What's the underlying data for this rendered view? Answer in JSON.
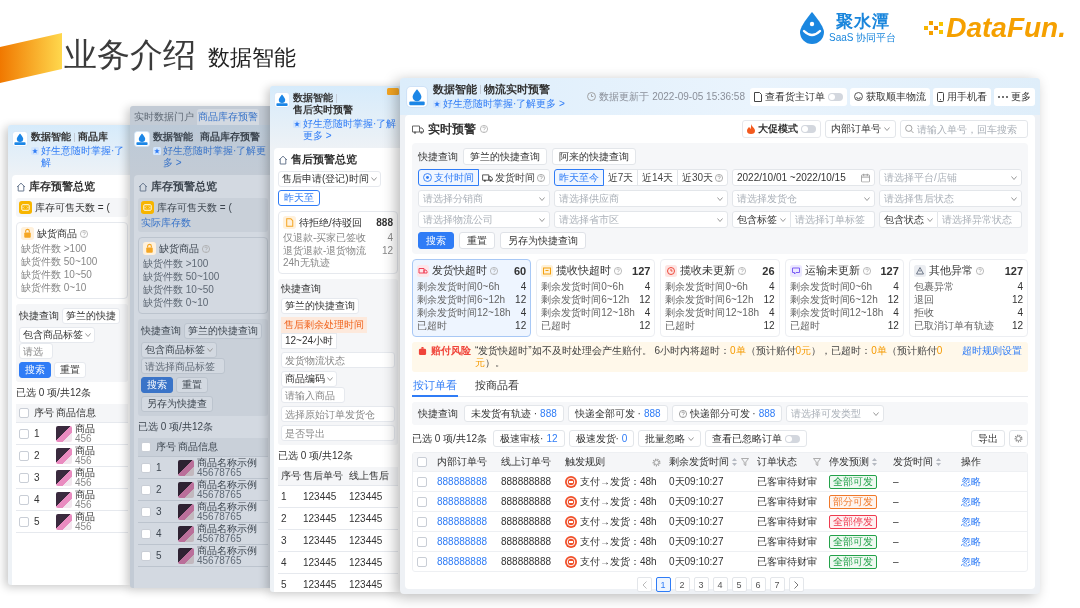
{
  "slide": {
    "title": "业务介绍",
    "subtitle": "数据智能"
  },
  "logos": [
    {
      "kind": "jushuitan",
      "name": "聚水潭",
      "tagline": "SaaS 协同平台"
    },
    {
      "kind": "datafun",
      "name": "DataFun."
    }
  ],
  "windows": [
    {
      "kind": "inventory",
      "dimmed": false,
      "app": "数据智能",
      "page": "商品库",
      "tagline": "好生意随时掌握·了解",
      "overview": "库存预警总览",
      "formula": "库存可售天数 = (",
      "card": {
        "title": "缺货商品",
        "lines": [
          "缺货件数 >100",
          "缺货件数 50~100",
          "缺货件数 10~50",
          "缺货件数 0~10"
        ]
      },
      "quick_query": {
        "label": "快捷查询",
        "items": [
          "笋兰的快捷"
        ]
      },
      "filter": {
        "label": "包含商品标签",
        "placeholder": "请选"
      },
      "buttons": [
        {
          "kind": "primary",
          "label": "搜索"
        },
        {
          "kind": "default",
          "label": "重置"
        }
      ],
      "selection": "已选 0 项/共12条",
      "table": {
        "select_all": false,
        "columns": [
          "序号",
          "商品信息"
        ],
        "rows": [
          {
            "checked": false,
            "index": "1",
            "name": "商品",
            "code": "456"
          },
          {
            "checked": false,
            "index": "2",
            "name": "商品",
            "code": "456"
          },
          {
            "checked": false,
            "index": "3",
            "name": "商品",
            "code": "456"
          },
          {
            "checked": false,
            "index": "4",
            "name": "商品",
            "code": "456"
          },
          {
            "checked": false,
            "index": "5",
            "name": "商品",
            "code": "456"
          }
        ]
      }
    },
    {
      "kind": "inventory",
      "dimmed": true,
      "tabs": [
        {
          "label": "实时数据门户",
          "selected": false
        },
        {
          "label": "商品库存预警",
          "selected": true
        }
      ],
      "app": "数据智能",
      "page": "商品库存预警",
      "tagline": "好生意随时掌握·了解更多 >",
      "overview": "库存预警总览",
      "formula": "库存可售天数 = (",
      "formula_term": "实际库存数",
      "card": {
        "title": "缺货商品",
        "lines": [
          "缺货件数 >100",
          "缺货件数 50~100",
          "缺货件数 10~50",
          "缺货件数 0~10"
        ]
      },
      "quick_query": {
        "label": "快捷查询",
        "items": [
          "笋兰的快捷查询"
        ]
      },
      "filter": {
        "label": "包含商品标签",
        "placeholder": "请选择商品标签"
      },
      "buttons": [
        {
          "kind": "primary",
          "label": "搜索"
        },
        {
          "kind": "default",
          "label": "重置"
        },
        {
          "kind": "default",
          "label": "另存为快捷查"
        }
      ],
      "selection": "已选 0 项/共12条",
      "table": {
        "select_all": false,
        "columns": [
          "序号",
          "商品信息"
        ],
        "rows": [
          {
            "checked": false,
            "index": "1",
            "name": "商品名称示例",
            "code": "45678765"
          },
          {
            "checked": false,
            "index": "2",
            "name": "商品名称示例",
            "code": "45678765"
          },
          {
            "checked": false,
            "index": "3",
            "name": "商品名称示例",
            "code": "45678765"
          },
          {
            "checked": false,
            "index": "4",
            "name": "商品名称示例",
            "code": "45678765"
          },
          {
            "checked": false,
            "index": "5",
            "name": "商品名称示例",
            "code": "45678765"
          }
        ]
      }
    },
    {
      "kind": "aftersale",
      "dimmed": false,
      "app": "数据智能",
      "page": "售后实时预警",
      "tagline": "好生意随时掌握·了解更多 >",
      "overview": "售后预警总览",
      "time_select": "售后申请(登记)时间",
      "range": "昨天至",
      "card": {
        "title": "待拒绝/待驳回",
        "count": "888",
        "lines": [
          {
            "label": "仅退款-买家已签收",
            "value": "4"
          },
          {
            "label": "退货退款-退货物流24h无轨迹",
            "value": "12"
          }
        ]
      },
      "quick_query": {
        "label": "快捷查询",
        "items": [
          "笋兰的快捷查询"
        ]
      },
      "deadline": {
        "label": "售后剩余处理时间",
        "value": "12~24小时"
      },
      "fields": [
        {
          "kind": "input",
          "placeholder": "发货物流状态"
        },
        {
          "kind": "compound",
          "label": "商品编码",
          "placeholder": "请输入商品"
        },
        {
          "kind": "input",
          "placeholder": "选择原始订单发货仓"
        },
        {
          "kind": "input",
          "placeholder": "是否导出"
        }
      ],
      "selection": "已选 0 项/共12条",
      "table": {
        "columns": [
          "序号",
          "售后单号",
          "线上售后"
        ],
        "rows": [
          {
            "cells": [
              "1",
              "123445",
              "123445"
            ]
          },
          {
            "cells": [
              "2",
              "123445",
              "123445"
            ]
          },
          {
            "cells": [
              "3",
              "123445",
              "123445"
            ]
          },
          {
            "cells": [
              "4",
              "123445",
              "123445"
            ]
          },
          {
            "cells": [
              "5",
              "123445",
              "123445"
            ]
          }
        ]
      }
    }
  ],
  "main_window": {
    "app": "数据智能",
    "page": "物流实时预警",
    "tagline": "好生意随时掌握·了解更多 >",
    "updated": "数据更新于 2022-09-05 15:36:58",
    "actions": [
      {
        "kind": "toggle",
        "label": "查看货主订单",
        "on": false
      },
      {
        "kind": "button",
        "label": "获取顺丰物流"
      },
      {
        "kind": "button",
        "label": "用手机看"
      },
      {
        "kind": "more",
        "label": "更多"
      }
    ],
    "section": "实时预警",
    "promo": {
      "label": "大促模式",
      "on": false
    },
    "search": {
      "scope": "内部订单号",
      "placeholder": "请输入单号，回车搜索"
    },
    "quick_query": {
      "label": "快捷查询",
      "items": [
        "笋兰的快捷查询",
        "阿来的快捷查询"
      ]
    },
    "filters": [
      {
        "kind": "segment",
        "options": [
          {
            "label": "支付时间",
            "selected": true,
            "help": false
          },
          {
            "label": "发货时间",
            "selected": false,
            "help": true
          }
        ]
      },
      {
        "kind": "segment",
        "options": [
          {
            "label": "昨天至今",
            "selected": true,
            "help": false
          },
          {
            "label": "近7天",
            "selected": false,
            "help": false
          },
          {
            "label": "近14天",
            "selected": false,
            "help": false
          },
          {
            "label": "近30天",
            "selected": false,
            "help": true
          }
        ]
      },
      {
        "kind": "date",
        "value": "2022/10/01 ~2022/10/15"
      },
      {
        "kind": "select",
        "placeholder": "请选择平台/店铺"
      },
      {
        "kind": "select",
        "placeholder": "请选择分销商"
      },
      {
        "kind": "select",
        "placeholder": "请选择供应商"
      },
      {
        "kind": "select",
        "placeholder": "请选择发货仓"
      },
      {
        "kind": "select",
        "placeholder": "请选择售后状态"
      },
      {
        "kind": "select",
        "placeholder": "请选择物流公司"
      },
      {
        "kind": "select",
        "placeholder": "请选择省市区"
      },
      {
        "kind": "compound",
        "label": "包含标签",
        "placeholder": "请选择订单标签"
      },
      {
        "kind": "compound",
        "label": "包含状态",
        "placeholder": "请选择异常状态"
      }
    ],
    "buttons": [
      {
        "kind": "primary",
        "label": "搜索"
      },
      {
        "kind": "default",
        "label": "重置"
      },
      {
        "kind": "default",
        "label": "另存为快捷查询"
      }
    ],
    "cards": [
      {
        "kind": "ship",
        "title": "发货快超时",
        "count": "60",
        "selected": true,
        "lines": [
          {
            "label": "剩余发货时间0~6h",
            "value": "4"
          },
          {
            "label": "剩余发货时间6~12h",
            "value": "12"
          },
          {
            "label": "剩余发货时间12~18h",
            "value": "4"
          },
          {
            "label": "已超时",
            "value": "12"
          }
        ]
      },
      {
        "kind": "pickup",
        "title": "揽收快超时",
        "count": "127",
        "selected": false,
        "lines": [
          {
            "label": "剩余发货时间0~6h",
            "value": "4"
          },
          {
            "label": "剩余发货时间6~12h",
            "value": "12"
          },
          {
            "label": "剩余发货时间12~18h",
            "value": "4"
          },
          {
            "label": "已超时",
            "value": "12"
          }
        ]
      },
      {
        "kind": "stale",
        "title": "揽收未更新",
        "count": "26",
        "selected": false,
        "lines": [
          {
            "label": "剩余发货时间0~6h",
            "value": "4"
          },
          {
            "label": "剩余发货时间6~12h",
            "value": "12"
          },
          {
            "label": "剩余发货时间12~18h",
            "value": "4"
          },
          {
            "label": "已超时",
            "value": "12"
          }
        ]
      },
      {
        "kind": "transit",
        "title": "运输未更新",
        "count": "127",
        "selected": false,
        "lines": [
          {
            "label": "剩余发货时间0~6h",
            "value": "4"
          },
          {
            "label": "剩余发货时间6~12h",
            "value": "12"
          },
          {
            "label": "剩余发货时间12~18h",
            "value": "4"
          },
          {
            "label": "已超时",
            "value": "12"
          }
        ]
      },
      {
        "kind": "other",
        "title": "其他异常",
        "count": "127",
        "selected": false,
        "lines": [
          {
            "label": "包裹异常",
            "value": "4"
          },
          {
            "label": "退回",
            "value": "12"
          },
          {
            "label": "拒收",
            "value": "4"
          },
          {
            "label": "已取消订单有轨迹",
            "value": "12"
          }
        ]
      }
    ],
    "alert": {
      "tag": "赔付风险",
      "parts": [
        {
          "text": "“发货快超时”如不及时处理会产生赔付。 6小时内将超时：",
          "highlight": false
        },
        {
          "text": "0单",
          "highlight": true
        },
        {
          "text": "（预计赔付",
          "highlight": false
        },
        {
          "text": "0元",
          "highlight": true
        },
        {
          "text": "），已超时：",
          "highlight": false
        },
        {
          "text": "0单",
          "highlight": true
        },
        {
          "text": "（预计赔付",
          "highlight": false
        },
        {
          "text": "0元",
          "highlight": true
        },
        {
          "text": "）。",
          "highlight": false
        }
      ],
      "link": "超时规则设置"
    },
    "view_tabs": [
      {
        "label": "按订单看",
        "selected": true
      },
      {
        "label": "按商品看",
        "selected": false
      }
    ],
    "order_quick": {
      "label": "快捷查询",
      "chips": [
        {
          "label": "未发货有轨迹 ·",
          "count": "888",
          "help": false
        },
        {
          "label": "快递全部可发 ·",
          "count": "888",
          "help": false
        },
        {
          "label": "快递部分可发 ·",
          "count": "888",
          "help": true
        }
      ],
      "type_placeholder": "请选择可发类型"
    },
    "toolbar": {
      "selection": "已选 0 项/共12条",
      "actions": [
        {
          "kind": "count",
          "label": "极速审核·",
          "count": "12"
        },
        {
          "kind": "count",
          "label": "极速发货·",
          "count": "0"
        },
        {
          "kind": "menu",
          "label": "批量忽略"
        },
        {
          "kind": "toggle",
          "label": "查看已忽略订单",
          "on": false
        }
      ],
      "export": "导出"
    },
    "table": {
      "select_all": false,
      "columns": [
        {
          "label": "内部订单号",
          "sort": false,
          "filter": false,
          "gear": false
        },
        {
          "label": "线上订单号",
          "sort": false,
          "filter": false,
          "gear": false
        },
        {
          "label": "触发规则",
          "sort": false,
          "filter": false,
          "gear": true
        },
        {
          "label": "剩余发货时间",
          "sort": true,
          "filter": true,
          "gear": false
        },
        {
          "label": "订单状态",
          "sort": false,
          "filter": true,
          "gear": false
        },
        {
          "label": "停发预测",
          "sort": true,
          "filter": false,
          "gear": false
        },
        {
          "label": "发货时间",
          "sort": true,
          "filter": false,
          "gear": false
        },
        {
          "label": "操作",
          "sort": false,
          "filter": false,
          "gear": false
        }
      ],
      "rows": [
        {
          "checked": false,
          "order_no": "888888888",
          "online_no": "888888888",
          "rule": "支付→发货：48h",
          "remaining": "0天09:10:27",
          "status": "已客审待财审",
          "forecast": {
            "label": "全部可发",
            "color": "#23a14a"
          },
          "ship_time": "–",
          "action": "忽略"
        },
        {
          "checked": false,
          "order_no": "888888888",
          "online_no": "888888888",
          "rule": "支付→发货：48h",
          "remaining": "0天09:10:27",
          "status": "已客审待财审",
          "forecast": {
            "label": "部分可发",
            "color": "#f0782a"
          },
          "ship_time": "–",
          "action": "忽略"
        },
        {
          "checked": false,
          "order_no": "888888888",
          "online_no": "888888888",
          "rule": "支付→发货：48h",
          "remaining": "0天09:10:27",
          "status": "已客审待财审",
          "forecast": {
            "label": "全部停发",
            "color": "#ee3b4f"
          },
          "ship_time": "–",
          "action": "忽略"
        },
        {
          "checked": false,
          "order_no": "888888888",
          "online_no": "888888888",
          "rule": "支付→发货：48h",
          "remaining": "0天09:10:27",
          "status": "已客审待财审",
          "forecast": {
            "label": "全部可发",
            "color": "#23a14a"
          },
          "ship_time": "–",
          "action": "忽略"
        },
        {
          "checked": false,
          "order_no": "888888888",
          "online_no": "888888888",
          "rule": "支付→发货：48h",
          "remaining": "0天09:10:27",
          "status": "已客审待财审",
          "forecast": {
            "label": "全部可发",
            "color": "#23a14a"
          },
          "ship_time": "–",
          "action": "忽略"
        }
      ]
    },
    "pagination": [
      {
        "label": "1",
        "selected": true
      },
      {
        "label": "2",
        "selected": false
      },
      {
        "label": "3",
        "selected": false
      },
      {
        "label": "4",
        "selected": false
      },
      {
        "label": "5",
        "selected": false
      },
      {
        "label": "6",
        "selected": false
      },
      {
        "label": "7",
        "selected": false
      }
    ]
  }
}
